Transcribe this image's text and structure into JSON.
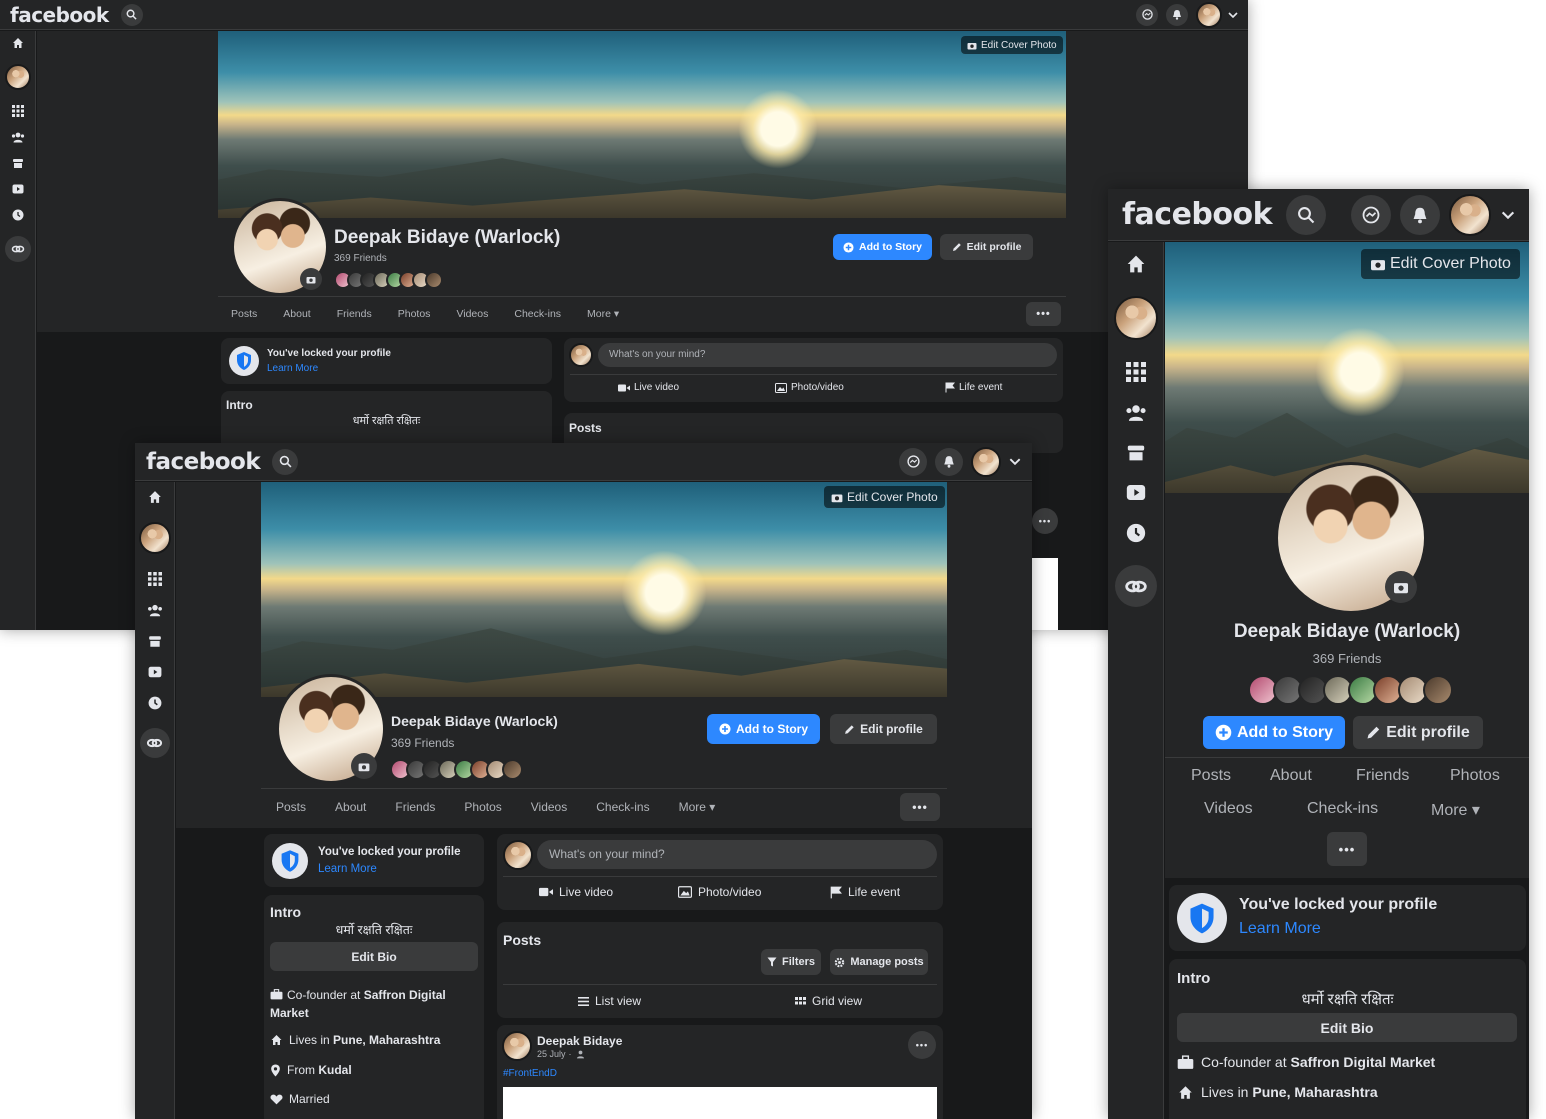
{
  "app": {
    "logo": "facebook"
  },
  "profile": {
    "name": "Deepak Bidaye (Warlock)",
    "friends_count": "369 Friends",
    "edit_cover_label": "Edit Cover Photo",
    "add_story_label": "Add to Story",
    "edit_profile_label": "Edit profile"
  },
  "tabs": [
    "Posts",
    "About",
    "Friends",
    "Photos",
    "Videos",
    "Check-ins",
    "More"
  ],
  "locked": {
    "title": "You've locked your profile",
    "link": "Learn More"
  },
  "intro": {
    "title": "Intro",
    "bio": "धर्मो रक्षति रक्षितः",
    "edit_bio_label": "Edit Bio",
    "work_prefix": "Co-founder at ",
    "work_place": "Saffron Digital Market",
    "home_prefix": "Lives in ",
    "home_place": "Pune, Maharashtra",
    "from_prefix": "From ",
    "from_place": "Kudal",
    "relationship": "Married"
  },
  "composer": {
    "placeholder": "What's on your mind?",
    "live_label": "Live video",
    "photo_label": "Photo/video",
    "life_label": "Life event"
  },
  "posts_section": {
    "title": "Posts",
    "filters_label": "Filters",
    "manage_label": "Manage posts",
    "list_view_label": "List view",
    "grid_view_label": "Grid view"
  },
  "post": {
    "author": "Deepak Bidaye",
    "date": "25 July",
    "hashtag": "#FrontEndD"
  },
  "colors": {
    "accent": "#2d88ff",
    "bg": "#18191a",
    "surface": "#242526"
  }
}
